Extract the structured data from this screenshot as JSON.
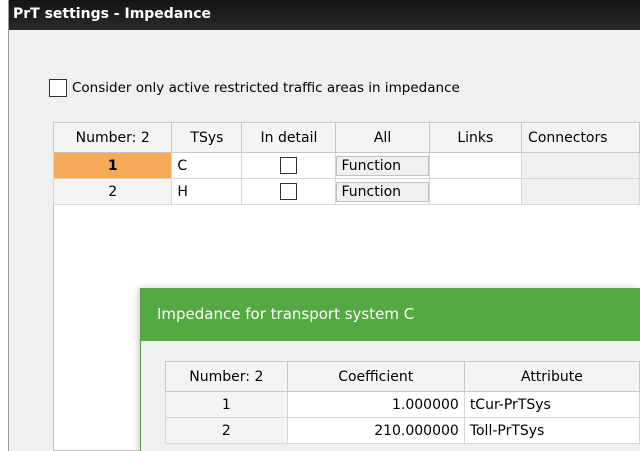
{
  "window": {
    "title": "PrT settings - Impedance"
  },
  "option": {
    "label": "Consider only active restricted traffic areas in impedance",
    "checked": false
  },
  "tsys_table": {
    "headers": [
      "Number: 2",
      "TSys",
      "In detail",
      "All",
      "Links",
      "Connectors"
    ],
    "rows": [
      {
        "number": "1",
        "tsys": "C",
        "in_detail": false,
        "all": "Function",
        "selected": true
      },
      {
        "number": "2",
        "tsys": "H",
        "in_detail": false,
        "all": "Function",
        "selected": false
      }
    ]
  },
  "dialog": {
    "title": "Impedance for transport system C",
    "headers": [
      "Number: 2",
      "Coefficient",
      "Attribute"
    ],
    "rows": [
      {
        "number": "1",
        "coefficient": "1.000000",
        "attribute": "tCur-PrTSys"
      },
      {
        "number": "2",
        "coefficient": "210.000000",
        "attribute": "Toll-PrTSys"
      }
    ]
  },
  "colors": {
    "titlebar": "#1c1c1c",
    "dialog_title": "#54a942",
    "selected_row": "#f5ab5a"
  }
}
